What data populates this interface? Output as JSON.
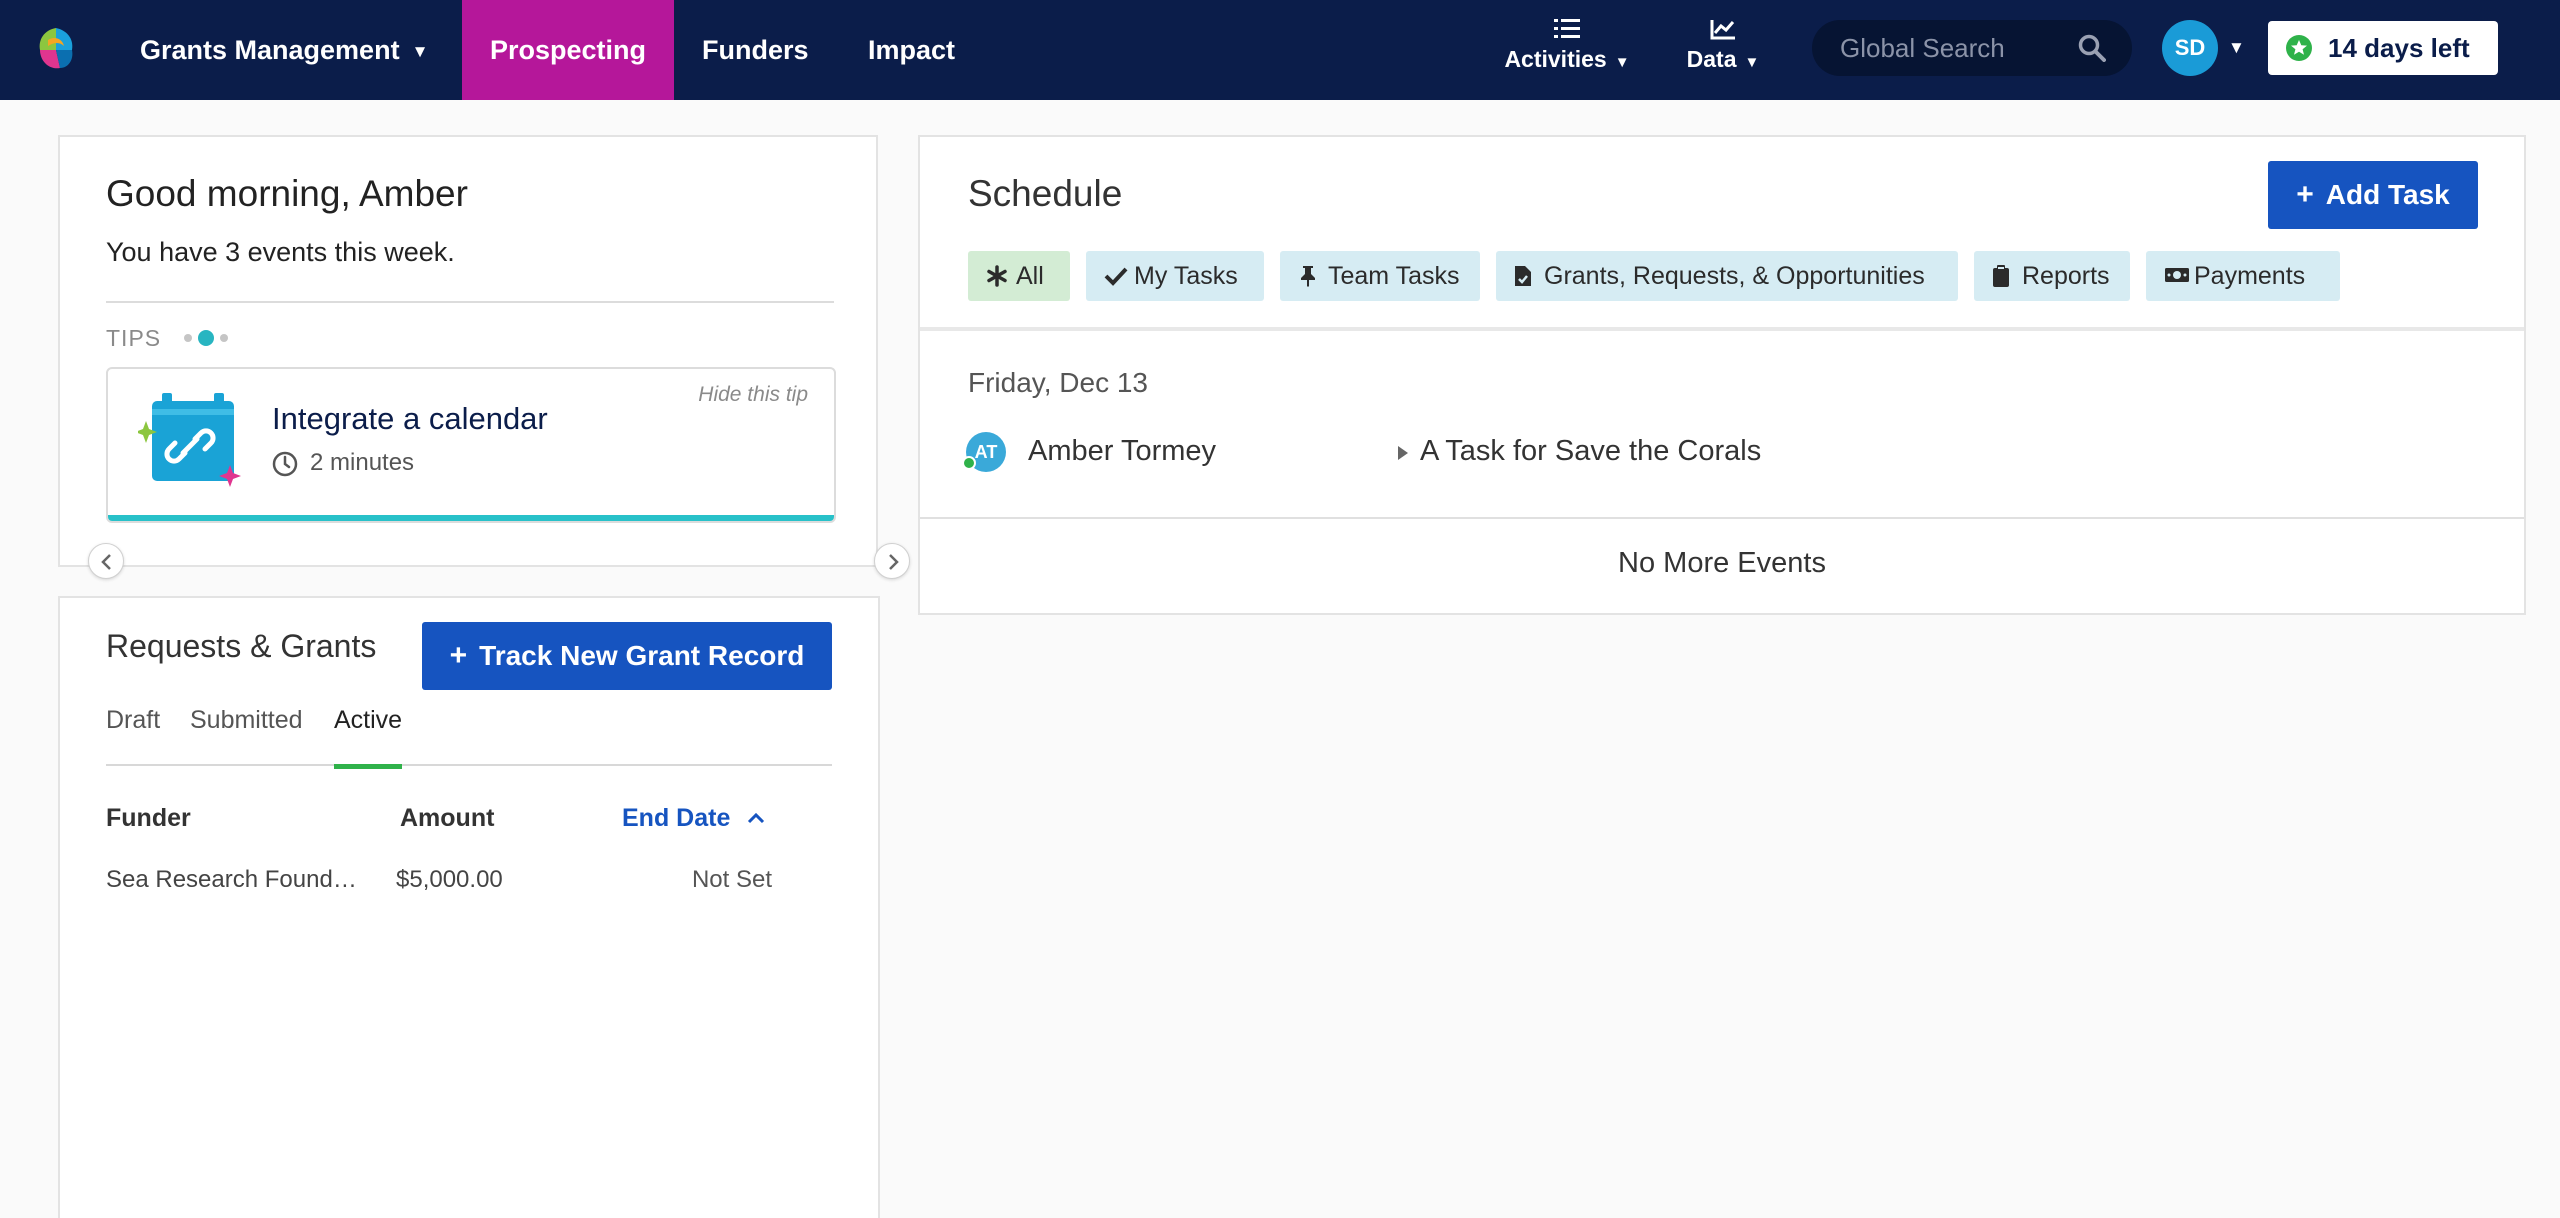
{
  "nav": {
    "grants_management": "Grants Management",
    "prospecting": "Prospecting",
    "funders": "Funders",
    "impact": "Impact",
    "activities": "Activities",
    "data": "Data",
    "search_placeholder": "Global Search",
    "user_initials": "SD",
    "trial_label": "14 days left",
    "colors": {
      "navbar_bg": "#0b1d4a",
      "active_tab": "#b5179a",
      "badge_green": "#2fb24a"
    }
  },
  "greeting": {
    "title": "Good morning, Amber",
    "subtitle": "You have 3 events this week.",
    "tips_label": "TIPS",
    "tip": {
      "hide_label": "Hide this tip",
      "title": "Integrate a calendar",
      "duration": "2 minutes",
      "icon": "calendar-link-icon"
    }
  },
  "requests": {
    "title": "Requests & Grants",
    "track_button": "Track New Grant Record",
    "tabs": [
      "Draft",
      "Submitted",
      "Active"
    ],
    "active_tab": "Active",
    "columns": {
      "funder": "Funder",
      "amount": "Amount",
      "end_date": "End Date"
    },
    "rows": [
      {
        "funder": "Sea Research Foundation",
        "amount": "$5,000.00",
        "end_date": "Not Set"
      }
    ]
  },
  "schedule": {
    "title": "Schedule",
    "add_task_button": "Add Task",
    "filters": [
      "All",
      "My Tasks",
      "Team Tasks",
      "Grants, Requests, & Opportunities",
      "Reports",
      "Payments"
    ],
    "active_filter": "All",
    "date_heading": "Friday, Dec 13",
    "events": [
      {
        "initials": "AT",
        "person": "Amber Tormey",
        "task": "A Task for Save the Corals"
      }
    ],
    "no_more_label": "No More Events"
  }
}
